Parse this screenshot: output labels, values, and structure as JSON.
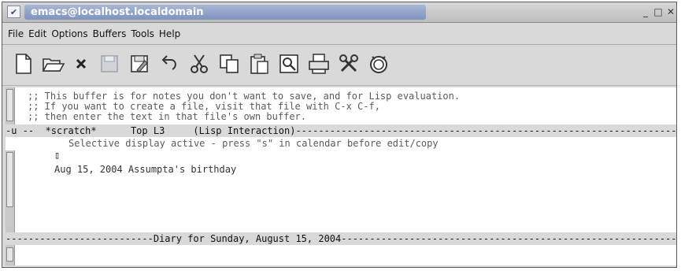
{
  "window": {
    "title": "emacs@localhost.localdomain",
    "controls": {
      "minimize": "_",
      "maximize": "□",
      "close": "✕"
    }
  },
  "menubar": {
    "items": [
      "File",
      "Edit",
      "Options",
      "Buffers",
      "Tools",
      "Help"
    ]
  },
  "toolbar": {
    "tools": [
      "new-file-icon",
      "open-folder-icon",
      "close-icon",
      "save-icon",
      "save-as-icon",
      "undo-icon",
      "cut-icon",
      "copy-icon",
      "paste-icon",
      "search-icon",
      "print-icon",
      "preferences-icon",
      "info-icon"
    ]
  },
  "scratch_buffer": {
    "lines": [
      ";; This buffer is for notes you don't want to save, and for Lisp evaluation.",
      ";; If you want to create a file, visit that file with C-x C-f,",
      ";; then enter the text in that file's own buffer."
    ],
    "modeline": "-u --  *scratch*      Top L3     (Lisp Interaction)--------------------------------------------------------------------------------"
  },
  "diary_buffer": {
    "header": "Selective display active - press \"s\" in calendar before edit/copy",
    "cursor": "▯",
    "entry": "Aug 15, 2004 Assumpta's birthday",
    "modeline": "--------------------------Diary for Sunday, August 15, 2004--------------------------------------------------------------------------------"
  },
  "minibuffer": {
    "text": ""
  },
  "colors": {
    "title_bar": "#8fa2c9",
    "window_bg": "#d9d9d9",
    "editor_bg": "#ffffff",
    "text": "#5a5a5a"
  }
}
